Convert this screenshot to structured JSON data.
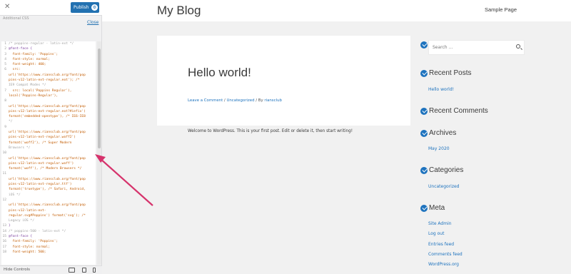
{
  "sidebar": {
    "close_glyph": "✕",
    "publish_label": "Publish",
    "gear_glyph": "⚙",
    "subtext": "Additional CSS",
    "close_link": "Close",
    "css_lines": [
      {
        "n": "1",
        "t": "/* poppins-regular - latin-ext */",
        "k": "c"
      },
      {
        "n": "2",
        "t": "@font-face {",
        "k": "k"
      },
      {
        "n": "3",
        "t": "  font-family: 'Poppins';",
        "k": ""
      },
      {
        "n": "4",
        "t": "  font-style: normal;",
        "k": ""
      },
      {
        "n": "5",
        "t": "  font-weight: 400;",
        "k": ""
      },
      {
        "n": "6",
        "t": "  src:",
        "k": ""
      },
      {
        "n": "",
        "t": "url('https://www.riansclub.org/font/pop",
        "k": ""
      },
      {
        "n": "",
        "t": "pins-v12-latin-ext-regular.eot'); /*",
        "k": ""
      },
      {
        "n": "",
        "t": "IE9 Compat Modes */",
        "k": "c"
      },
      {
        "n": "7",
        "t": "  src: local('Poppins Regular'),",
        "k": ""
      },
      {
        "n": "",
        "t": "local('Poppins-Regular'),",
        "k": ""
      },
      {
        "n": "8",
        "t": "",
        "k": ""
      },
      {
        "n": "",
        "t": "url('https://www.riansclub.org/font/pop",
        "k": ""
      },
      {
        "n": "",
        "t": "pins-v12-latin-ext-regular.eot?#iefix')",
        "k": ""
      },
      {
        "n": "",
        "t": "format('embedded-opentype'), /* IE6-IE8",
        "k": ""
      },
      {
        "n": "",
        "t": "*/",
        "k": "c"
      },
      {
        "n": "9",
        "t": "",
        "k": ""
      },
      {
        "n": "",
        "t": "url('https://www.riansclub.org/font/pop",
        "k": ""
      },
      {
        "n": "",
        "t": "pins-v12-latin-ext-regular.woff2')",
        "k": ""
      },
      {
        "n": "",
        "t": "format('woff2'), /* Super Modern",
        "k": ""
      },
      {
        "n": "",
        "t": "Browsers */",
        "k": "c"
      },
      {
        "n": "10",
        "t": "",
        "k": ""
      },
      {
        "n": "",
        "t": "url('https://www.riansclub.org/font/pop",
        "k": ""
      },
      {
        "n": "",
        "t": "pins-v12-latin-ext-regular.woff')",
        "k": ""
      },
      {
        "n": "",
        "t": "format('woff'), /* Modern Browsers */",
        "k": ""
      },
      {
        "n": "11",
        "t": "",
        "k": ""
      },
      {
        "n": "",
        "t": "url('https://www.riansclub.org/font/pop",
        "k": ""
      },
      {
        "n": "",
        "t": "pins-v12-latin-ext-regular.ttf')",
        "k": ""
      },
      {
        "n": "",
        "t": "format('truetype'), /* Safari, Android,",
        "k": ""
      },
      {
        "n": "",
        "t": "iOS */",
        "k": "c"
      },
      {
        "n": "12",
        "t": "",
        "k": ""
      },
      {
        "n": "",
        "t": "url('https://www.riansclub.org/font/pop",
        "k": ""
      },
      {
        "n": "",
        "t": "pins-v12-latin-ext-",
        "k": ""
      },
      {
        "n": "",
        "t": "regular.svg#Poppins') format('svg'); /*",
        "k": ""
      },
      {
        "n": "",
        "t": "Legacy iOS */",
        "k": "c"
      },
      {
        "n": "13",
        "t": "}",
        "k": "k"
      },
      {
        "n": "14",
        "t": "/* poppins-500 - latin-ext */",
        "k": "c"
      },
      {
        "n": "15",
        "t": "@font-face {",
        "k": "k"
      },
      {
        "n": "16",
        "t": "  font-family: 'Poppins';",
        "k": ""
      },
      {
        "n": "17",
        "t": "  font-style: normal;",
        "k": ""
      },
      {
        "n": "18",
        "t": "  font-weight: 500;",
        "k": ""
      }
    ],
    "hide_controls": "Hide Controls"
  },
  "site": {
    "title": "My Blog",
    "nav": [
      "Sample Page"
    ],
    "post": {
      "title": "Hello world!",
      "meta_comment": "Leave a Comment",
      "meta_sep1": " / ",
      "meta_category": "Uncategorized",
      "meta_sep2": " / By ",
      "meta_author": "riansclub",
      "body": "Welcome to WordPress. This is your first post. Edit or delete it, then start writing!"
    },
    "sidebar": {
      "search_placeholder": "Search …",
      "recent_posts_title": "Recent Posts",
      "recent_posts": [
        "Hello world!"
      ],
      "recent_comments_title": "Recent Comments",
      "archives_title": "Archives",
      "archives": [
        "May 2020"
      ],
      "categories_title": "Categories",
      "categories": [
        "Uncategorized"
      ],
      "meta_title": "Meta",
      "meta_links": [
        "Site Admin",
        "Log out",
        "Entries feed",
        "Comments feed",
        "WordPress.org"
      ]
    }
  },
  "colors": {
    "accent": "#1e73be",
    "publish": "#2271b1",
    "arrow": "#d6336c"
  }
}
